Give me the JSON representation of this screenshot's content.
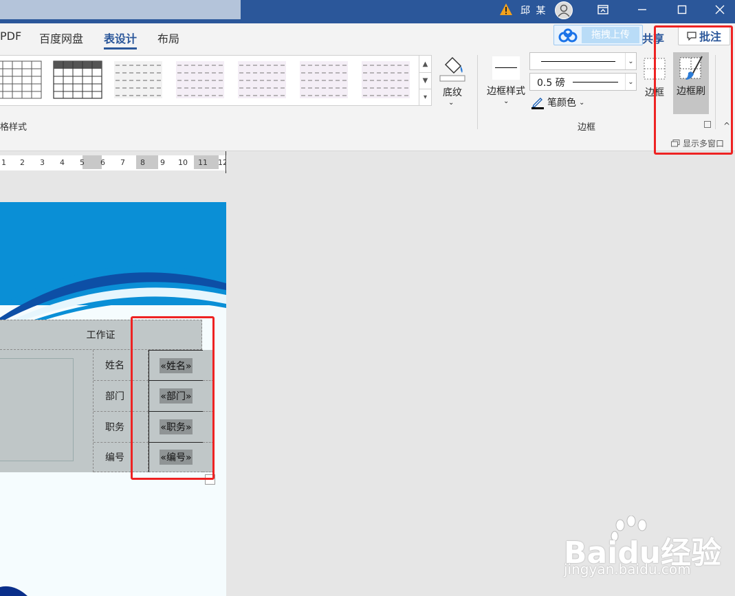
{
  "titlebar": {
    "user_name": "邱 某"
  },
  "ribbon": {
    "tabs": [
      {
        "label": "PDF"
      },
      {
        "label": "百度网盘"
      },
      {
        "label": "表设计"
      },
      {
        "label": "布局"
      }
    ],
    "upload_label": "拖拽上传",
    "share_label": "共享",
    "comment_label": "批注",
    "styles_group_label": "格样式",
    "shading_label": "底纹",
    "border_styles_label": "边框样式",
    "line_weight": "0.5 磅",
    "pen_color_label": "笔颜色",
    "borders_label": "边框",
    "border_painter_label": "边框刷",
    "borders_group_label": "边框",
    "multi_window_label": "显示多窗口"
  },
  "ruler": {
    "numbers": [
      "1",
      "2",
      "3",
      "4",
      "5",
      "6",
      "7",
      "8",
      "9",
      "10",
      "11",
      "12"
    ]
  },
  "card": {
    "title": "工作证",
    "rows": [
      {
        "label": "姓名",
        "field": "«姓名»"
      },
      {
        "label": "部门",
        "field": "«部门»"
      },
      {
        "label": "职务",
        "field": "«职务»"
      },
      {
        "label": "编号",
        "field": "«编号»"
      }
    ]
  },
  "watermark": {
    "brand": "Baidu经验",
    "url": "jingyan.baidu.com"
  },
  "colors": {
    "title_bar": "#2b579a",
    "accent": "#2b579a",
    "highlight": "#e22222",
    "table_fill": "#c0c7c8",
    "header_blue": "#0a8fd6"
  }
}
